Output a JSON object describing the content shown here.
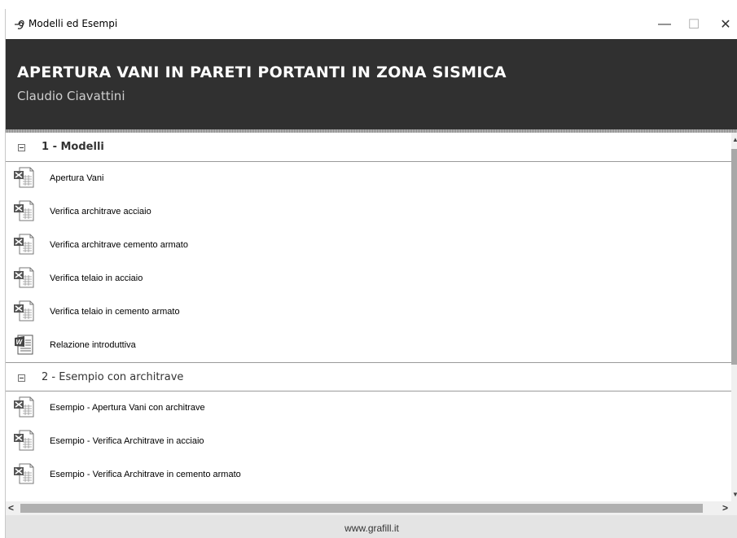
{
  "window": {
    "title": "Modelli ed Esempi",
    "controls": {
      "minimize": "—",
      "maximize": "☐",
      "close": "✕"
    },
    "icon": "app-curl-icon"
  },
  "banner": {
    "title": "APERTURA VANI IN PARETI PORTANTI IN ZONA SISMICA",
    "author": "Claudio Ciavattini",
    "background": "#303030"
  },
  "groups": [
    {
      "title": "1 - Modelli",
      "items": [
        {
          "label": "Apertura Vani",
          "icon": "excel-file-icon"
        },
        {
          "label": "Verifica architrave acciaio",
          "icon": "excel-file-icon"
        },
        {
          "label": "Verifica architrave cemento armato",
          "icon": "excel-file-icon"
        },
        {
          "label": "Verifica telaio in acciaio",
          "icon": "excel-file-icon"
        },
        {
          "label": "Verifica telaio in cemento armato",
          "icon": "excel-file-icon"
        },
        {
          "label": "Relazione introduttiva",
          "icon": "word-file-icon"
        }
      ]
    },
    {
      "title": "2 - Esempio con architrave",
      "items": [
        {
          "label": "Esempio - Apertura Vani con architrave",
          "icon": "excel-file-icon"
        },
        {
          "label": "Esempio - Verifica Architrave in acciaio",
          "icon": "excel-file-icon"
        },
        {
          "label": "Esempio - Verifica Architrave in cemento armato",
          "icon": "excel-file-icon"
        }
      ]
    }
  ],
  "scrollbar": {
    "left_arrow": "<",
    "right_arrow": ">"
  },
  "footer": {
    "text": "www.grafill.it"
  }
}
